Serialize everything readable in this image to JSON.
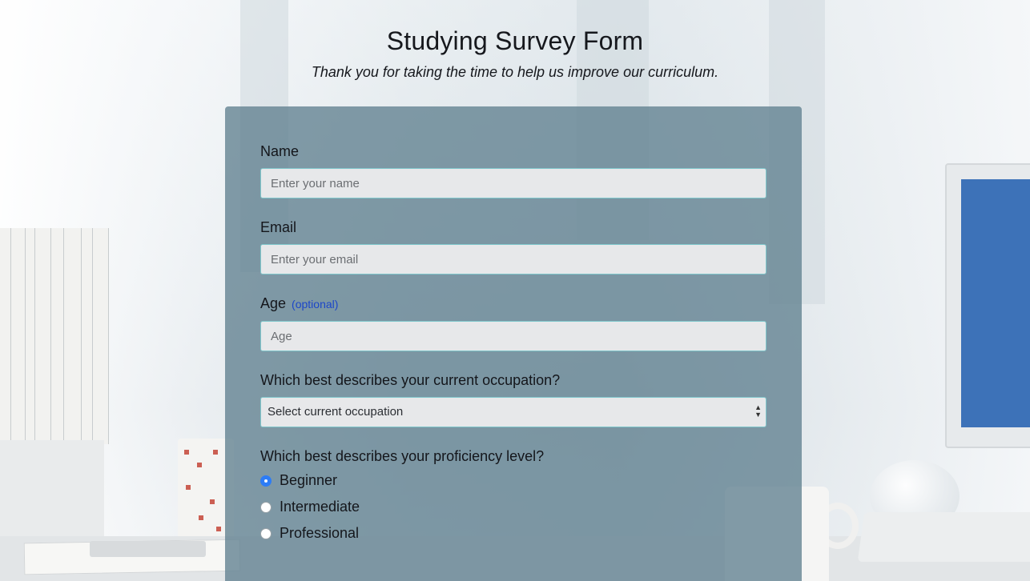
{
  "header": {
    "title": "Studying Survey Form",
    "subtitle": "Thank you for taking the time to help us improve our curriculum."
  },
  "form": {
    "name": {
      "label": "Name",
      "placeholder": "Enter your name",
      "value": ""
    },
    "email": {
      "label": "Email",
      "placeholder": "Enter your email",
      "value": ""
    },
    "age": {
      "label": "Age",
      "optional_label": "(optional)",
      "placeholder": "Age",
      "value": ""
    },
    "occupation": {
      "label": "Which best describes your current occupation?",
      "selected": "Select current occupation"
    },
    "proficiency": {
      "label": "Which best describes your proficiency level?",
      "options": [
        {
          "label": "Beginner",
          "checked": true
        },
        {
          "label": "Intermediate",
          "checked": false
        },
        {
          "label": "Professional",
          "checked": false
        }
      ]
    }
  },
  "colors": {
    "card": "#60808f",
    "input_border": "#7ec6cb",
    "optional_text": "#1c46c8",
    "radio_checked": "#2d7cf6"
  }
}
